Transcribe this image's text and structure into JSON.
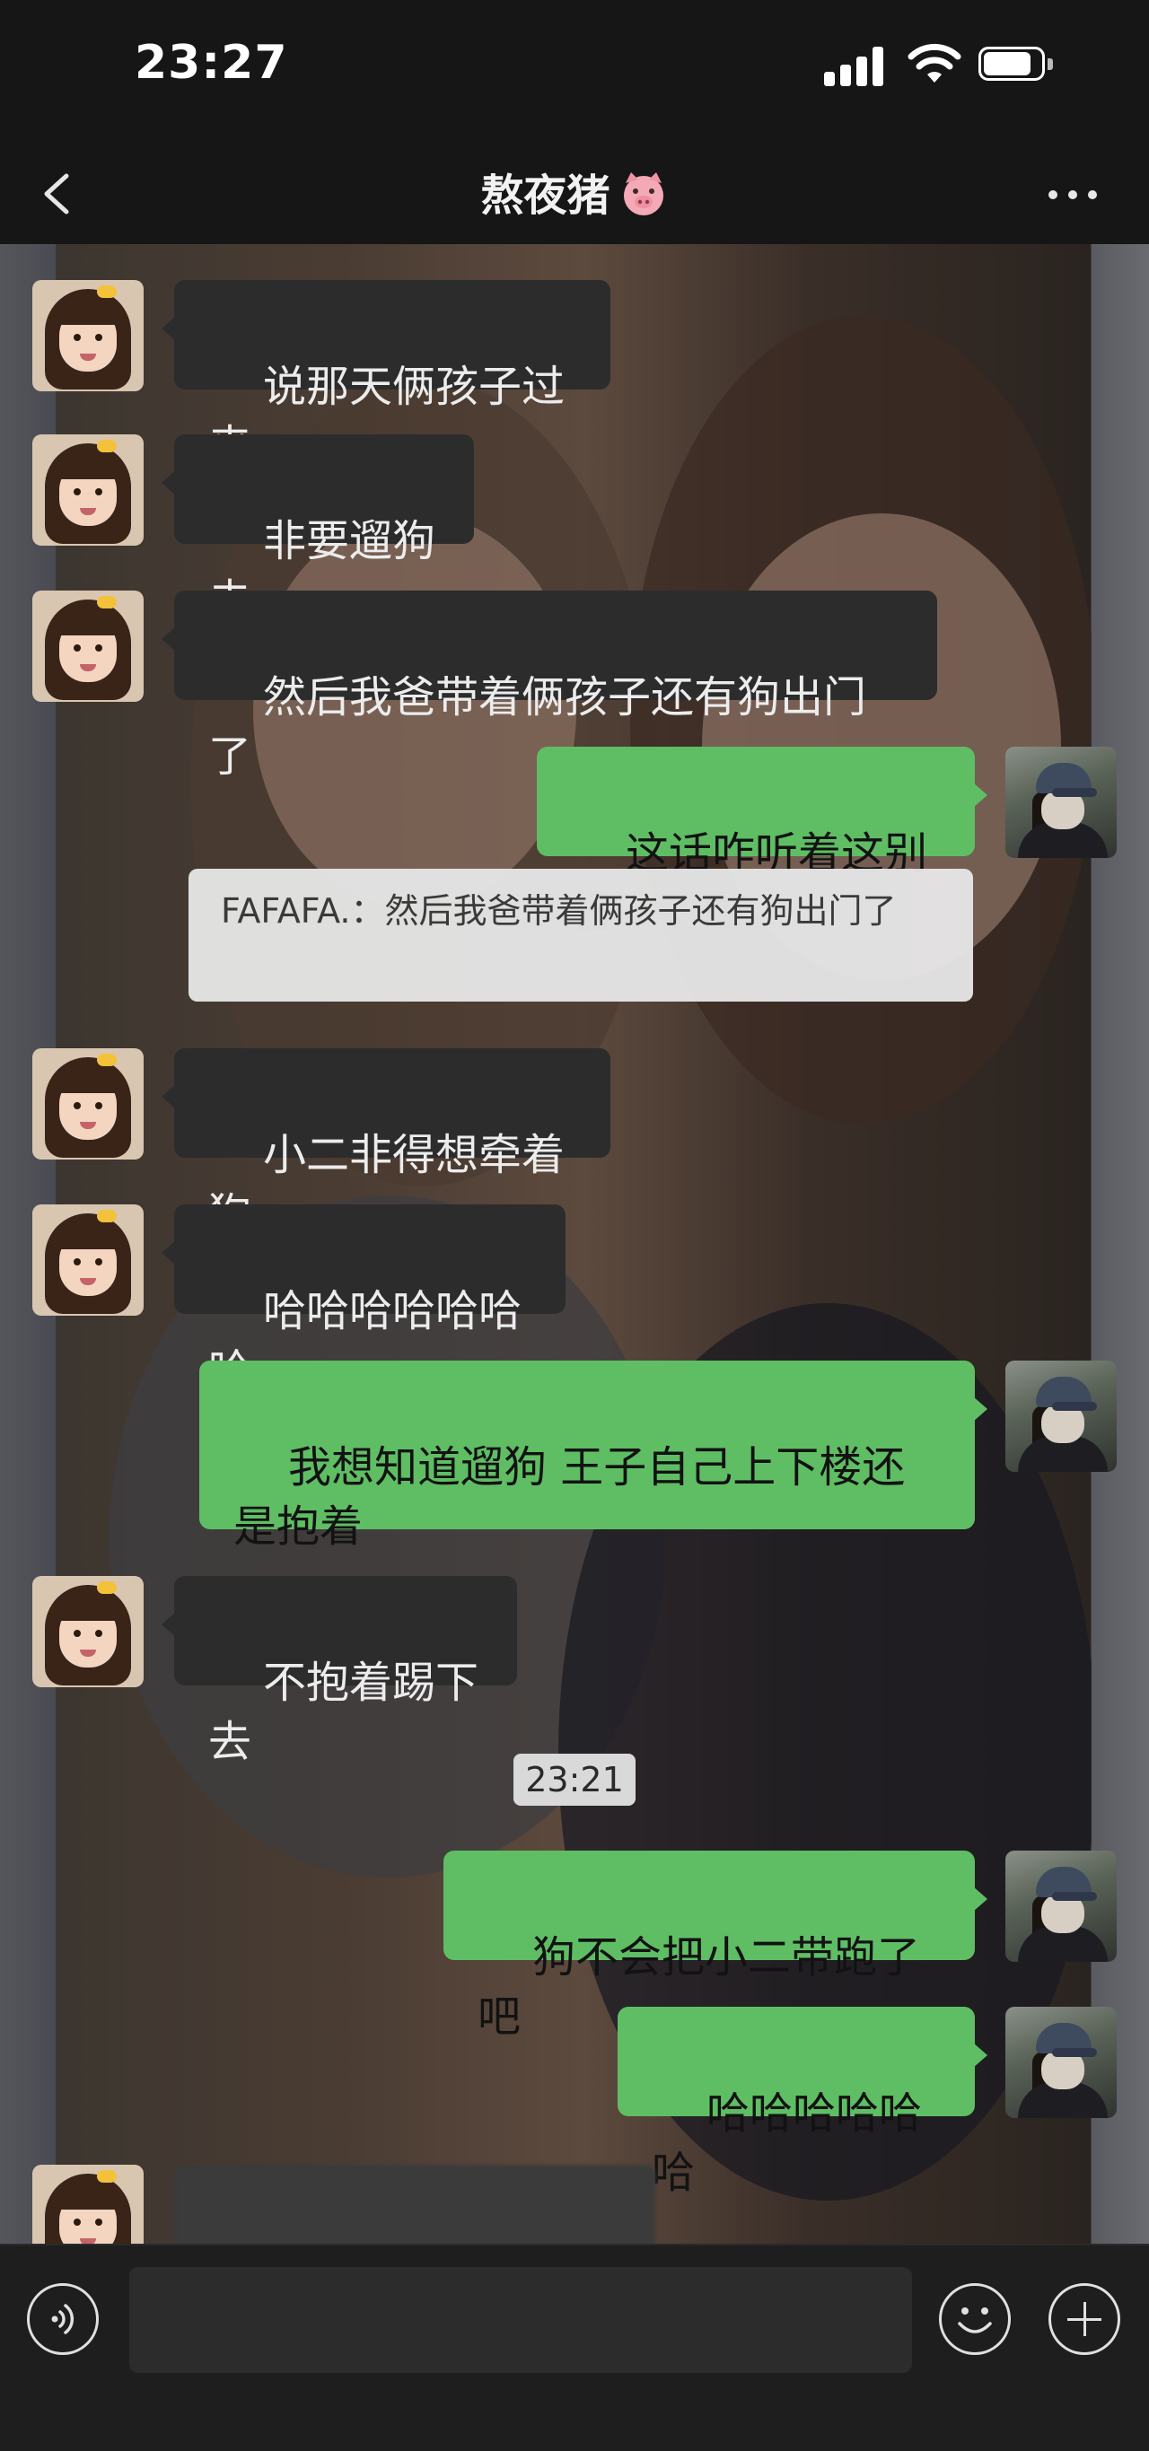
{
  "status_bar": {
    "time": "23:27",
    "signal_icon": "cellular-signal-icon",
    "wifi_icon": "wifi-icon",
    "battery_icon": "battery-icon"
  },
  "nav": {
    "back_icon": "chevron-left-icon",
    "title": "熬夜猪",
    "title_emoji": "pig-face-icon",
    "more_icon": "more-dots-icon"
  },
  "messages": [
    {
      "side": "in",
      "text": "说那天俩孩子过来"
    },
    {
      "side": "in",
      "text": "非要遛狗去"
    },
    {
      "side": "in",
      "text": "然后我爸带着俩孩子还有狗出门了"
    },
    {
      "side": "out",
      "text": "这话咋听着这别扭"
    },
    {
      "side": "quote",
      "text": "FAFAFA.：然后我爸带着俩孩子还有狗出门了"
    },
    {
      "side": "in",
      "text": "小二非得想牵着狗"
    },
    {
      "side": "in",
      "text": "哈哈哈哈哈哈哈"
    },
    {
      "side": "out",
      "text": "我想知道遛狗 王子自己上下楼还是抱着"
    },
    {
      "side": "in",
      "text": "不抱着踢下去"
    },
    {
      "side": "time",
      "text": "23:21"
    },
    {
      "side": "out",
      "text": "狗不会把小二带跑了吧"
    },
    {
      "side": "out",
      "text": "哈哈哈哈哈哈"
    }
  ],
  "input_bar": {
    "voice_icon": "voice-icon",
    "emoji_icon": "emoji-icon",
    "plus_icon": "plus-icon",
    "input_value": ""
  },
  "colors": {
    "outgoing_bubble": "#5fbe64",
    "incoming_bubble": "#2c2c2c",
    "bar_background": "#161616"
  }
}
